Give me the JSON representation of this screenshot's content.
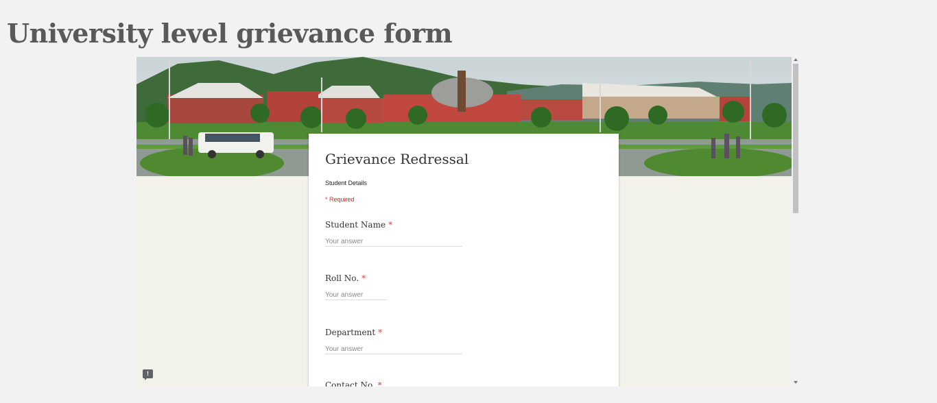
{
  "slide": {
    "title": "University level grievance form"
  },
  "form": {
    "title": "Grievance Redressal",
    "description": "Student Details",
    "required_note": "* Required",
    "questions": [
      {
        "label": "Student Name",
        "required_mark": "*",
        "placeholder": "Your answer"
      },
      {
        "label": "Roll No.",
        "required_mark": "*",
        "placeholder": "Your answer"
      },
      {
        "label": "Department",
        "required_mark": "*",
        "placeholder": "Your answer"
      },
      {
        "label": "Contact No.",
        "required_mark": "*"
      }
    ]
  },
  "feedback": {
    "glyph": "!"
  },
  "colors": {
    "page_bg": "#f2f2f2",
    "form_bg": "#f3f2ea",
    "required_red": "#db4437",
    "title_gray": "#595959"
  }
}
